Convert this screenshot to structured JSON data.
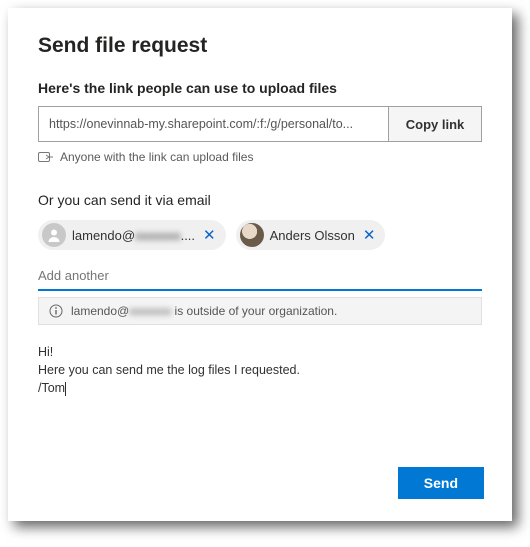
{
  "title": "Send file request",
  "link_section": {
    "heading": "Here's the link people can use to upload files",
    "url": "https://onevinnab-my.sharepoint.com/:f:/g/personal/to...",
    "copy_label": "Copy link",
    "permission_text": "Anyone with the link can upload files"
  },
  "email_section": {
    "heading": "Or you can send it via email",
    "recipients": [
      {
        "display": "lamendo@",
        "redacted": "xxxxxxx",
        "suffix": "....",
        "has_photo": false
      },
      {
        "display": "Anders Olsson",
        "has_photo": true
      }
    ],
    "add_placeholder": "Add another",
    "warning_prefix": "lamendo@",
    "warning_redacted": "xxxxxxx",
    "warning_suffix": " is outside of your organization.",
    "message": "Hi!\nHere you can send me the log files I requested.\n/Tom"
  },
  "send_label": "Send"
}
